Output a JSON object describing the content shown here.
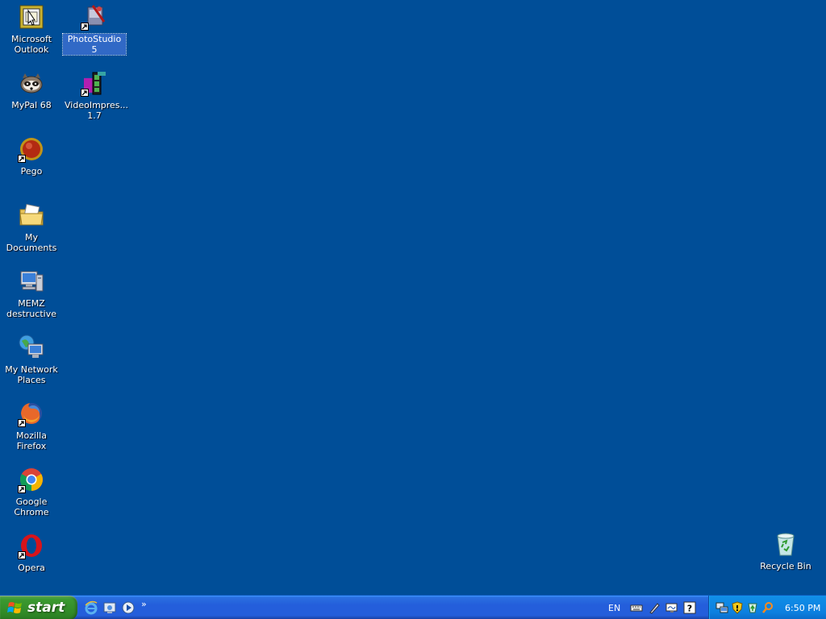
{
  "desktop": {
    "background_color": "#004E98",
    "icons": {
      "outlook": {
        "label": "Microsoft\nOutlook",
        "icon": "outlook-icon"
      },
      "photostudio": {
        "label": "PhotoStudio 5",
        "icon": "photostudio-icon",
        "selected": true
      },
      "mypal": {
        "label": "MyPal 68",
        "icon": "mypal-icon"
      },
      "videoimpression": {
        "label": "VideoImpres...\n1.7",
        "icon": "videoimpression-icon"
      },
      "pego": {
        "label": "Pego",
        "icon": "pego-icon"
      },
      "my_documents": {
        "label": "My Documents",
        "icon": "folder-documents-icon"
      },
      "memz": {
        "label": "MEMZ\ndestructive",
        "icon": "my-computer-icon"
      },
      "network": {
        "label": "My Network\nPlaces",
        "icon": "network-places-icon"
      },
      "firefox": {
        "label": "Mozilla Firefox",
        "icon": "firefox-icon"
      },
      "chrome": {
        "label": "Google Chrome",
        "icon": "chrome-icon"
      },
      "opera": {
        "label": "Opera",
        "icon": "opera-icon"
      },
      "recycle_bin": {
        "label": "Recycle Bin",
        "icon": "recycle-bin-icon"
      }
    }
  },
  "taskbar": {
    "start_label": "start",
    "quick_launch": [
      "internet-explorer-icon",
      "show-desktop-icon",
      "media-player-icon"
    ],
    "more_glyph": "»",
    "language": "EN",
    "language_bar_icons": [
      "keyboard-icon",
      "pen-icon",
      "handwriting-icon",
      "help-icon"
    ],
    "tray_icons": [
      "network-connection-icon",
      "security-shield-icon",
      "update-icon",
      "search-icon"
    ],
    "clock": "6:50 PM"
  },
  "colors": {
    "desktop": "#004E98",
    "taskbar": "#245EDB",
    "start_button": "#3C9A31",
    "tray": "#0F8AE5",
    "selection": "#3169C6"
  }
}
